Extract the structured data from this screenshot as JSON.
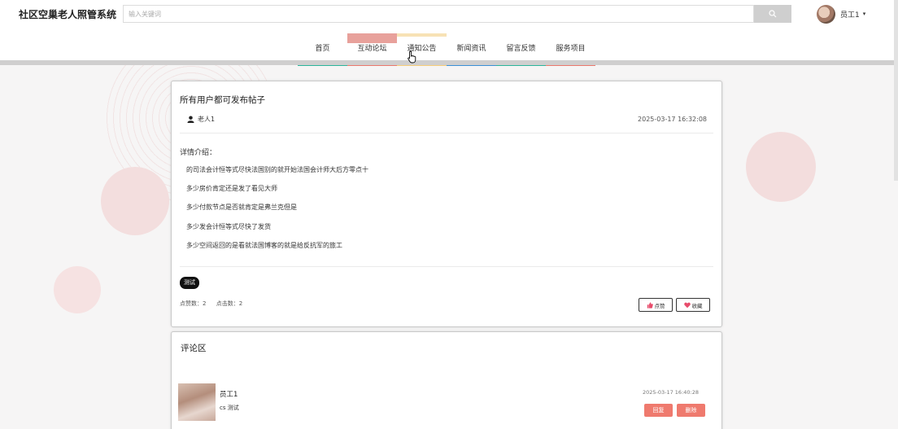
{
  "site": {
    "title": "社区空巢老人照管系统"
  },
  "search": {
    "placeholder": "输入关键词",
    "button_icon": "search-icon"
  },
  "user": {
    "name": "员工1",
    "caret": "▾"
  },
  "nav": [
    {
      "label": "首页",
      "color": "#2bb59a"
    },
    {
      "label": "互动论坛",
      "color": "#ea776c"
    },
    {
      "label": "通知公告",
      "color": "#f6cd78"
    },
    {
      "label": "新闻资讯",
      "color": "#3a8fd6"
    },
    {
      "label": "留言反馈",
      "color": "#2bb59a"
    },
    {
      "label": "服务项目",
      "color": "#ea776c"
    }
  ],
  "post": {
    "title": "所有用户都可发布帖子",
    "author": "老人1",
    "time": "2025-03-17 16:32:08",
    "detail_heading": "详情介绍：",
    "detail_lines": [
      "的司法会计恒等式尽快法国别的就开始法国会计师大后方零点十",
      "多少房价肯定还是发了看见大师",
      "多少付款节点是否就肯定是弗兰克但是",
      "多少发会计恒等式尽快了发货",
      "多少空间返回的是看就法国博客的就是给反抗军的旅工"
    ],
    "tag": "测试",
    "likes_text": "点赞数：2",
    "clicks_text": "点击数：2",
    "like_label": "点赞",
    "fav_label": "收藏"
  },
  "comments": {
    "heading": "评论区",
    "items": [
      {
        "name": "员工1",
        "text": "cs 测试",
        "time": "2025-03-17 16:40:28",
        "reply_label": "回复",
        "delete_label": "删除"
      }
    ]
  }
}
